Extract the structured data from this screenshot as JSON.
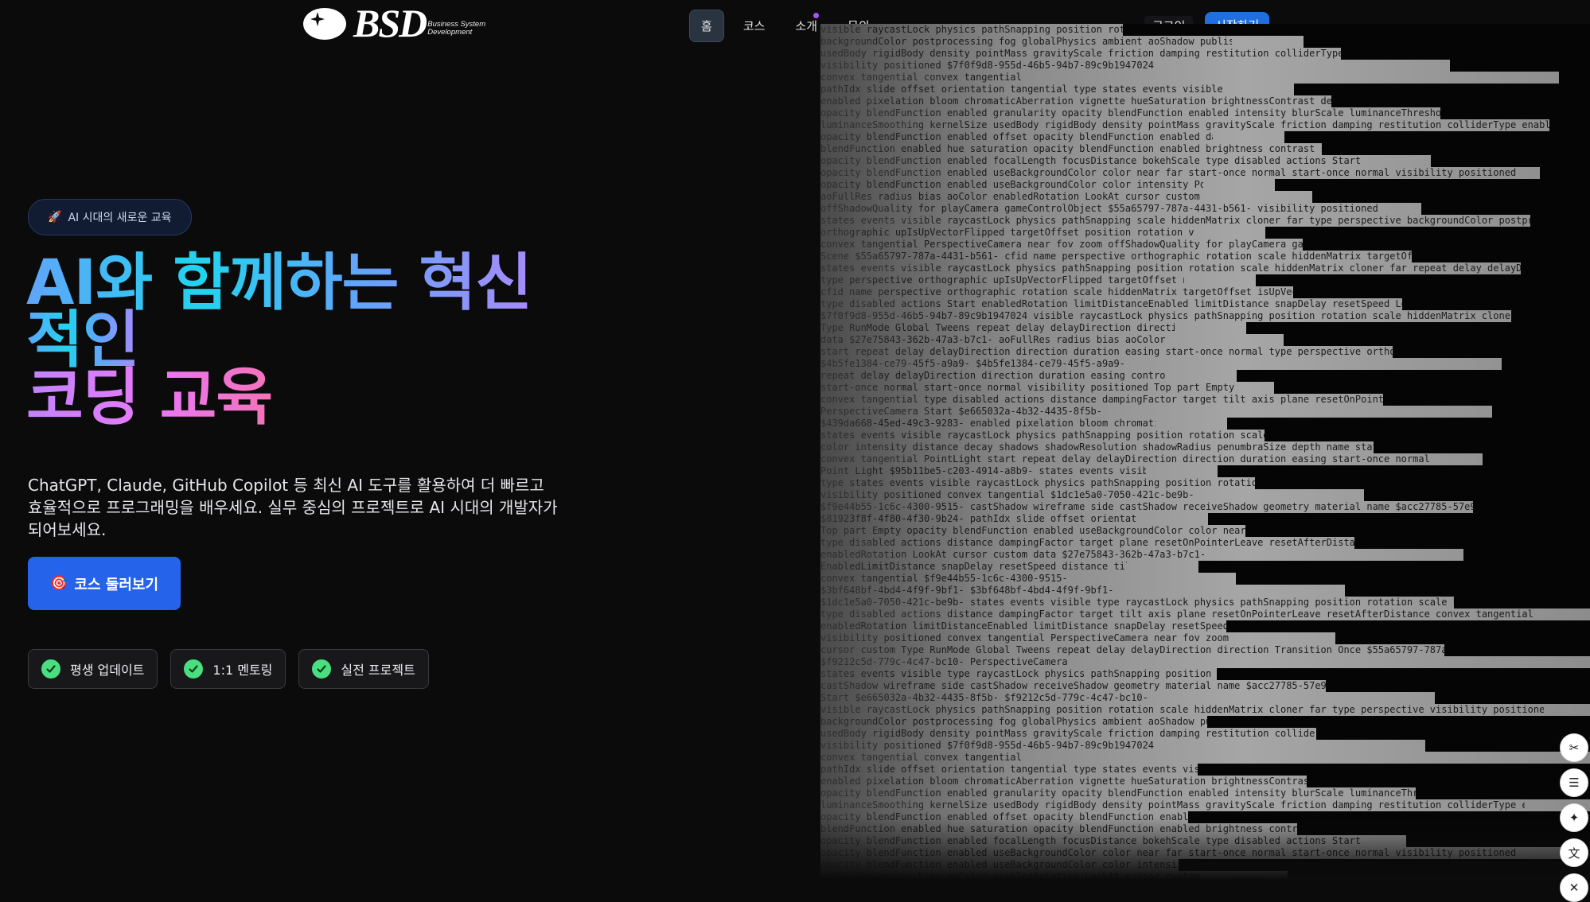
{
  "brand": {
    "name": "BSD",
    "tagline_line1": "Business System",
    "tagline_line2": "Development"
  },
  "nav": {
    "items": [
      {
        "label": "홈",
        "active": true
      },
      {
        "label": "코스",
        "active": false
      },
      {
        "label": "소개",
        "active": false,
        "has_dot": true
      },
      {
        "label": "문의",
        "active": false
      }
    ],
    "login_label": "로그인",
    "start_label": "시작하기"
  },
  "hero": {
    "badge_icon": "🚀",
    "badge_text": "AI 시대의 새로운 교육",
    "title_line1": "AI와 함께하는 혁신",
    "title_line2": "적인",
    "title_line3": "코딩 교육",
    "description": "ChatGPT, Claude, GitHub Copilot 등 최신 AI 도구를 활용하여 더 빠르고 효율적으로 프로그래밍을 배우세요. 실무 중심의 프로젝트로 AI 시대의 개발자가 되어보세요.",
    "cta_icon": "🎯",
    "cta_label": "코스 둘러보기",
    "features": [
      "평생 업데이트",
      "1:1 멘토링",
      "실전 프로젝트"
    ]
  },
  "code_art": {
    "fragments": [
      "visible raycastLock physics pathSnapping position rotation scale hiddenMatrix cloner far type perspective",
      "backgroundColor postprocessing fog globalPhysics ambient aoShadow publish camera name Page",
      "usedBody rigidBody density pointMass gravityScale friction damping restitution colliderType enabledRotation",
      "visibility positioned",
      "convex tangential",
      "pathIdx slide offset orientation tangential",
      "enabled pixelation bloom chromaticAberration vignette hueSaturation brightnessContrast depthOfField noise",
      "opacity blendFunction enabled granularity opacity blendFunction enabled intensity blurScale luminanceThreshold",
      "luminanceSmoothing kernelSize",
      "opacity blendFunction enabled offset opacity blendFunction enabled darkness offset",
      "blendFunction enabled hue saturation opacity blendFunction enabled brightness contrast",
      "opacity blendFunction enabled focalLength focusDistance bokehScale",
      "opacity blendFunction enabled useBackgroundColor color near far",
      "opacity blendFunction enabled useBackgroundColor color intensity",
      "aoFullRes radius bias aoColor",
      "offShadowQuality for playCamera gameControlObject $55a65797-787a-4431-b561-",
      "states events visible raycastLock physics pathSnapping scale hiddenMatrix cloner far type perspective",
      "orthographic upIsUpVectorFlipped targetOffset position rotation visibility positioned",
      "convex tangential PerspectiveCamera near fov zoom",
      "Scene $55a65797-787a-4431-b561-",
      "states events visible raycastLock physics pathSnapping position rotation scale hiddenMatrix cloner far",
      "type perspective orthographic upIsUpVectorFlipped targetOffset name data $07bdb557-c0d7-4392-",
      "cfid name perspective orthographic rotation scale hiddenMatrix targetOffset isUpVectorFlipped position State",
      "type disabled actions Start",
      "$7f0f9d8-955d-46b5-94b7-89c9b1947024",
      "Type RunMode Global Tweens repeat delay delayDirection direction Transition Once $55a65797-787a-4431-",
      "data $27e75843-362b-47a3-b7c1-",
      "start repeat delay delayDirection direction duration easing start-once normal",
      "$4b5fe1384-ce79-45f5-a9a9-",
      "repeat delay delayDirection direction duration easing control1 control2 $07bdb557-c0d7-4392-878a-",
      "start-once normal start-once normal visibility positioned",
      "convex tangential",
      "PerspectiveCamera",
      "$439da668-45ed-49c3-9283-",
      "states events visible raycastLock physics pathSnapping position rotation scale hiddenMatrix cloner far type",
      "color intensity distance decay shadows shadowResolution shadowRadius penumbraSize depth name",
      "convex tangential PointLight",
      "Point Light $95b11be5-c203-4914-a8b9-",
      "type states events visible raycastLock physics pathSnapping position rotation scale hiddenMatrix cloner",
      "visibility positioned convex tangential",
      "$f9e44b55-1c6c-4300-9515-",
      "$81923f8f-4f80-4f30-9b24-",
      "Top part Empty",
      "type disabled actions distance dampingFactor target plane resetOnPointerLeave resetAfterDistanceLimit limitDistance",
      "enabledRotation LookAt cursor custom",
      "EnabledLimitDistance snapDelay resetSpeed distance tilt axis enabledRotation LookAt",
      "convex tangential",
      "$3bf648bf-4bd4-4f9f-9bf1-",
      "$1dc1e5a0-7050-421c-be9b-",
      "type disabled actions distance dampingFactor target tilt axis plane resetOnPointerLeave resetAfterDistance",
      "enabledRotation limitDistanceEnabled limitDistance snapDelay resetSpeed LookAt",
      "visibility positioned",
      "cursor custom",
      "$f9212c5d-779c-4c47-bc10-",
      "states events visible type raycastLock physics pathSnapping position rotation scale hiddenMatrix cloner",
      "castShadow wireframe side castShadow receiveShadow geometry material name $acc27785-57e9-47d5-a",
      "Start $e665032a-4b32-4435-8f5b-"
    ]
  },
  "tools": [
    {
      "name": "scissors-icon",
      "glyph": "✂"
    },
    {
      "name": "list-icon",
      "glyph": "☰"
    },
    {
      "name": "sparkle-icon",
      "glyph": "✦"
    },
    {
      "name": "translate-icon",
      "glyph": "文"
    },
    {
      "name": "close-icon",
      "glyph": "✕"
    }
  ]
}
